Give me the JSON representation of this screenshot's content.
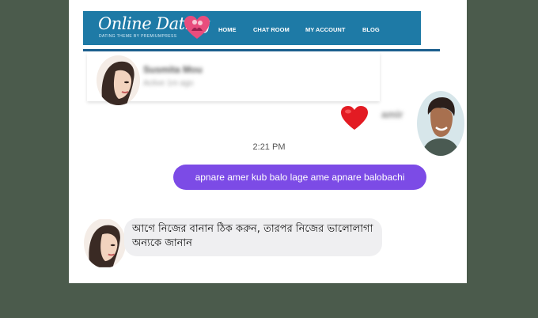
{
  "header": {
    "brand": "Online Dating",
    "tagline": "DATING THEME BY PREMIUMPRESS",
    "nav": [
      "HOME",
      "CHAT ROOM",
      "MY ACCOUNT",
      "BLOG"
    ]
  },
  "conversation": {
    "contact_name": "Susmita Mou",
    "contact_status": "Active 1m ago",
    "reaction_sender": "amir",
    "timestamp": "2:21 PM",
    "sent_message": "apnare amer kub balo lage ame apnare balobachi",
    "received_message": "আগে নিজের বানান ঠিক করুন, তারপর নিজের ভালোলাগা অন্যকে জানান"
  },
  "colors": {
    "nav_bg": "#1e7aa6",
    "sent_bubble": "#7c4be6",
    "received_bubble": "#efeff1",
    "reaction": "#e31b23",
    "page_bg": "#4b5b4c"
  },
  "icons": [
    "heart-logo-icon",
    "heart-reaction-icon"
  ]
}
